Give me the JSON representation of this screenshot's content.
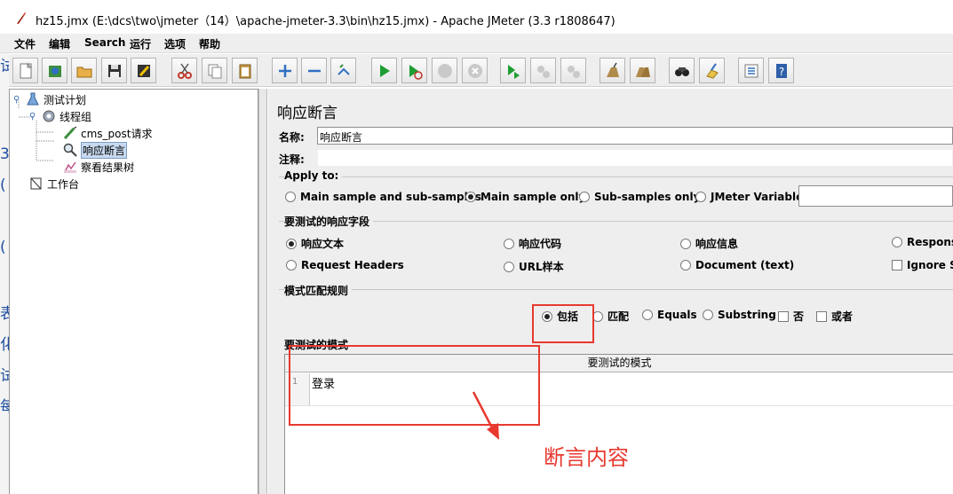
{
  "window": {
    "title": "hz15.jmx (E:\\dcs\\two\\jmeter（14）\\apache-jmeter-3.3\\bin\\hz15.jmx) - Apache JMeter (3.3 r1808647)"
  },
  "menu": [
    "文件",
    "编辑",
    "Search",
    "运行",
    "选项",
    "帮助"
  ],
  "toolbar": {
    "buttons": [
      "new-icon",
      "templates-icon",
      "open-icon",
      "save-icon",
      "save-as-icon",
      "cut-icon",
      "copy-icon",
      "paste-icon",
      "expand-icon",
      "collapse-icon",
      "toggle-icon",
      "start-icon",
      "start-no-pause-icon",
      "stop-icon",
      "shutdown-icon",
      "remote-start-icon",
      "remote-stop-icon",
      "remote-shutdown-icon",
      "clear-icon",
      "clear-all-icon",
      "search-icon",
      "reset-search-icon",
      "function-helper-icon",
      "help-icon"
    ]
  },
  "left_strip": [
    "试",
    "3",
    "(",
    "(",
    "表",
    "化",
    "试",
    "每"
  ],
  "tree": {
    "items": [
      {
        "label": "测试计划",
        "icon": "test-plan-icon"
      },
      {
        "label": "线程组",
        "icon": "thread-group-icon"
      },
      {
        "label": "cms_post请求",
        "icon": "sampler-icon"
      },
      {
        "label": "响应断言",
        "icon": "assertion-icon"
      },
      {
        "label": "察看结果树",
        "icon": "listener-icon"
      },
      {
        "label": "工作台",
        "icon": "workbench-icon"
      }
    ]
  },
  "panel": {
    "title": "响应断言",
    "name_label": "名称:",
    "name_value": "响应断言",
    "comment_label": "注释:",
    "comment_value": "",
    "apply_to": {
      "title": "Apply to:",
      "options": [
        "Main sample and sub-samples",
        "Main sample only",
        "Sub-samples only",
        "JMeter Variable"
      ],
      "selected": "Main sample only",
      "variable_value": ""
    },
    "response_field": {
      "title": "要测试的响应字段",
      "options": [
        "响应文本",
        "响应代码",
        "响应信息",
        "Response",
        "Request Headers",
        "URL样本",
        "Document (text)"
      ],
      "selected": "响应文本",
      "ignore_status": "Ignore St"
    },
    "pattern_rules": {
      "title": "模式匹配规则",
      "radios": [
        "包括",
        "匹配",
        "Equals",
        "Substring"
      ],
      "selected": "包括",
      "checks": [
        "否",
        "或者"
      ]
    },
    "patterns": {
      "title": "要测试的模式",
      "column_header": "要测试的模式",
      "line_number": "1",
      "rows": [
        "登录"
      ]
    }
  },
  "annotation": {
    "text": "断言内容",
    "color": "#e8392f"
  }
}
